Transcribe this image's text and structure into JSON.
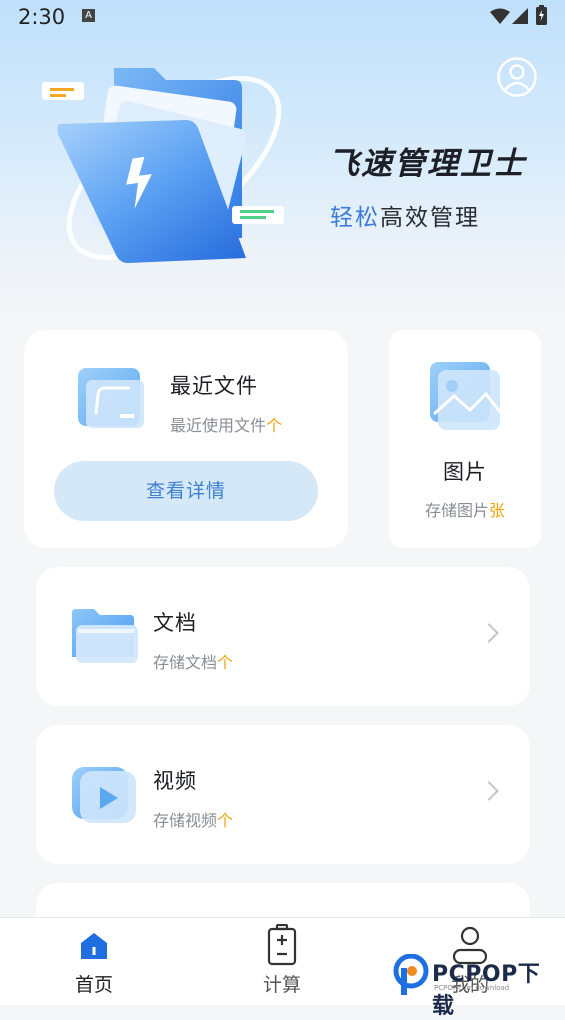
{
  "status_bar": {
    "time": "2:30",
    "notif_glyph": "A"
  },
  "header": {
    "title": "飞速管理卫士",
    "subtitle_highlight": "轻松",
    "subtitle_rest": "高效管理",
    "avatar_icon": "user-circle-icon"
  },
  "cards": {
    "recent": {
      "title": "最近文件",
      "sub_prefix": "最近使用文件",
      "sub_unit": "个",
      "button": "查看详情"
    },
    "images": {
      "title": "图片",
      "sub_prefix": "存储图片",
      "sub_unit": "张"
    },
    "docs": {
      "title": "文档",
      "sub_prefix": "存储文档",
      "sub_unit": "个"
    },
    "video": {
      "title": "视频",
      "sub_prefix": "存储视频",
      "sub_unit": "个"
    }
  },
  "bottom_nav": [
    {
      "label": "首页",
      "icon": "home-icon",
      "active": true
    },
    {
      "label": "计算",
      "icon": "calculator-icon",
      "active": false
    },
    {
      "label": "我的",
      "icon": "profile-icon",
      "active": false
    }
  ],
  "watermark": {
    "brand": "PCPOP下载",
    "small": "PCPOP.com download"
  },
  "colors": {
    "accent": "#3d7bd8",
    "unit": "#f0a40c",
    "nav_active": "#1f6fe0"
  }
}
